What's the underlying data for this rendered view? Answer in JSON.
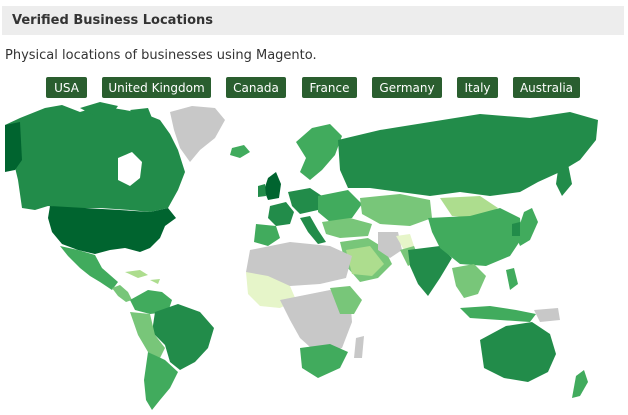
{
  "header": {
    "title": "Verified Business Locations"
  },
  "subtitle": "Physical locations of businesses using Magento.",
  "filters": [
    {
      "label": "USA"
    },
    {
      "label": "United Kingdom"
    },
    {
      "label": "Canada"
    },
    {
      "label": "France"
    },
    {
      "label": "Germany"
    },
    {
      "label": "Italy"
    },
    {
      "label": "Australia"
    }
  ],
  "colors": {
    "button_bg": "#2a5e2f",
    "header_bg": "#ededed",
    "darkest": "#00642f",
    "dark": "#228c4a",
    "medium": "#41ab5d",
    "light": "#78c679",
    "lighter": "#addd8e",
    "lightest": "#e6f5c9",
    "no_data": "#c8c8c8"
  }
}
